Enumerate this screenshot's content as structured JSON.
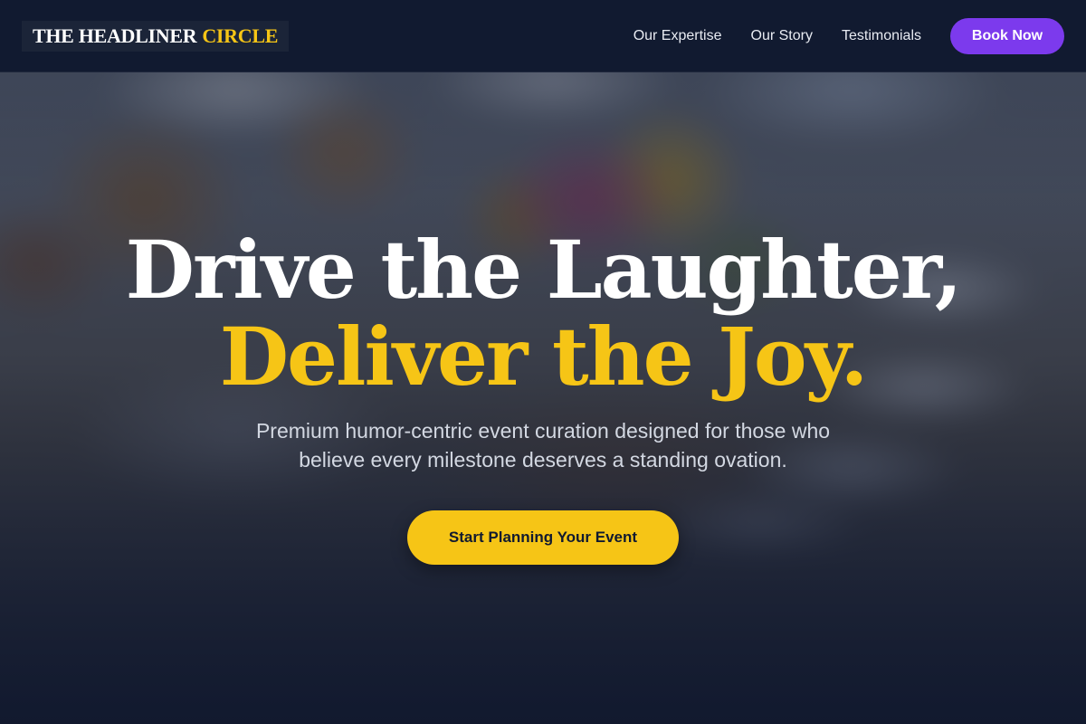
{
  "nav": {
    "logo_main": "THE HEADLINER",
    "logo_accent": "CIRCLE",
    "links": [
      {
        "label": "Our Expertise"
      },
      {
        "label": "Our Story"
      },
      {
        "label": "Testimonials"
      }
    ],
    "cta_label": "Book Now"
  },
  "hero": {
    "headline_line1": "Drive the Laughter,",
    "headline_line2": "Deliver the Joy.",
    "subtext": "Premium humor-centric event curation designed for those who believe every milestone deserves a standing ovation.",
    "cta_label": "Start Planning Your Event"
  },
  "colors": {
    "nav_bg": "#111a30",
    "accent_yellow": "#f6c516",
    "accent_purple": "#7c3aed",
    "text_white": "#ffffff"
  }
}
